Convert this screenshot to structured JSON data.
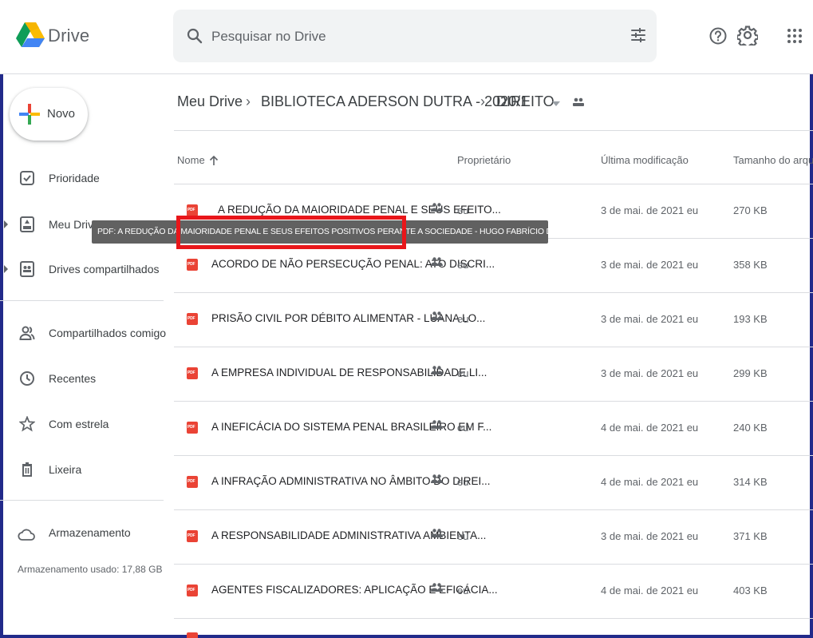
{
  "header": {
    "app_name": "Drive",
    "search_placeholder": "Pesquisar no Drive"
  },
  "sidebar": {
    "new_label": "Novo",
    "items": [
      {
        "label": "Prioridade",
        "icon": "priority-check-icon"
      },
      {
        "label": "Meu Drive",
        "icon": "my-drive-icon"
      },
      {
        "label": "Drives compartilhados",
        "icon": "shared-drives-icon"
      },
      {
        "label": "Compartilhados comigo",
        "icon": "shared-with-me-icon"
      },
      {
        "label": "Recentes",
        "icon": "clock-icon"
      },
      {
        "label": "Com estrela",
        "icon": "star-icon"
      },
      {
        "label": "Lixeira",
        "icon": "trash-icon"
      }
    ],
    "storage_label": "Armazenamento",
    "storage_used": "Armazenamento usado: 17,88 GB"
  },
  "breadcrumb": {
    "items": [
      "Meu Drive",
      "BIBLIOTECA ADERSON DUTRA - 2020/1",
      "DIREITO"
    ],
    "separator": "›"
  },
  "table": {
    "headers": {
      "name": "Nome",
      "owner": "Proprietário",
      "modified": "Última modificação",
      "size": "Tamanho do arquivo"
    },
    "rows": [
      {
        "name": "A REDUÇÃO DA MAIORIDADE PENAL E SEUS EFEITO...",
        "owner": "eu",
        "modified": "3 de mai. de 2021 eu",
        "size": "270 KB"
      },
      {
        "name": "ACORDO DE NÃO PERSECUÇÃO PENAL: ATO DISCRI...",
        "owner": "eu",
        "modified": "3 de mai. de 2021 eu",
        "size": "358 KB"
      },
      {
        "name": "PRISÃO CIVIL POR DÉBITO ALIMENTAR - LUANA LO...",
        "owner": "eu",
        "modified": "3 de mai. de 2021 eu",
        "size": "193 KB"
      },
      {
        "name": "A EMPRESA INDIVIDUAL DE RESPONSABILIDADE LI...",
        "owner": "eu",
        "modified": "3 de mai. de 2021 eu",
        "size": "299 KB"
      },
      {
        "name": "A INEFICÁCIA DO SISTEMA PENAL BRASILEIRO EM F...",
        "owner": "eu",
        "modified": "4 de mai. de 2021 eu",
        "size": "240 KB"
      },
      {
        "name": "A INFRAÇÃO ADMINISTRATIVA NO ÂMBITO DO DIREI...",
        "owner": "eu",
        "modified": "4 de mai. de 2021 eu",
        "size": "314 KB"
      },
      {
        "name": "A RESPONSABILIDADE ADMINISTRATIVA AMBIENTA...",
        "owner": "eu",
        "modified": "3 de mai. de 2021 eu",
        "size": "371 KB"
      },
      {
        "name": "AGENTES FISCALIZADORES: APLICAÇÃO E EFICÁCIA...",
        "owner": "eu",
        "modified": "4 de mai. de 2021 eu",
        "size": "403 KB"
      }
    ],
    "file_type_badge": "PDF"
  },
  "tooltip": {
    "text": "PDF: A REDUÇÃO DA MAIORIDADE PENAL E SEUS EFEITOS POSITIVOS PERANTE A SOCIEDADE - HUGO FABRÍCIO DOS SANTOS RÊGO."
  },
  "colors": {
    "highlight": "#e8161a",
    "pdf": "#ea4335",
    "background": "#1b1f6b"
  }
}
